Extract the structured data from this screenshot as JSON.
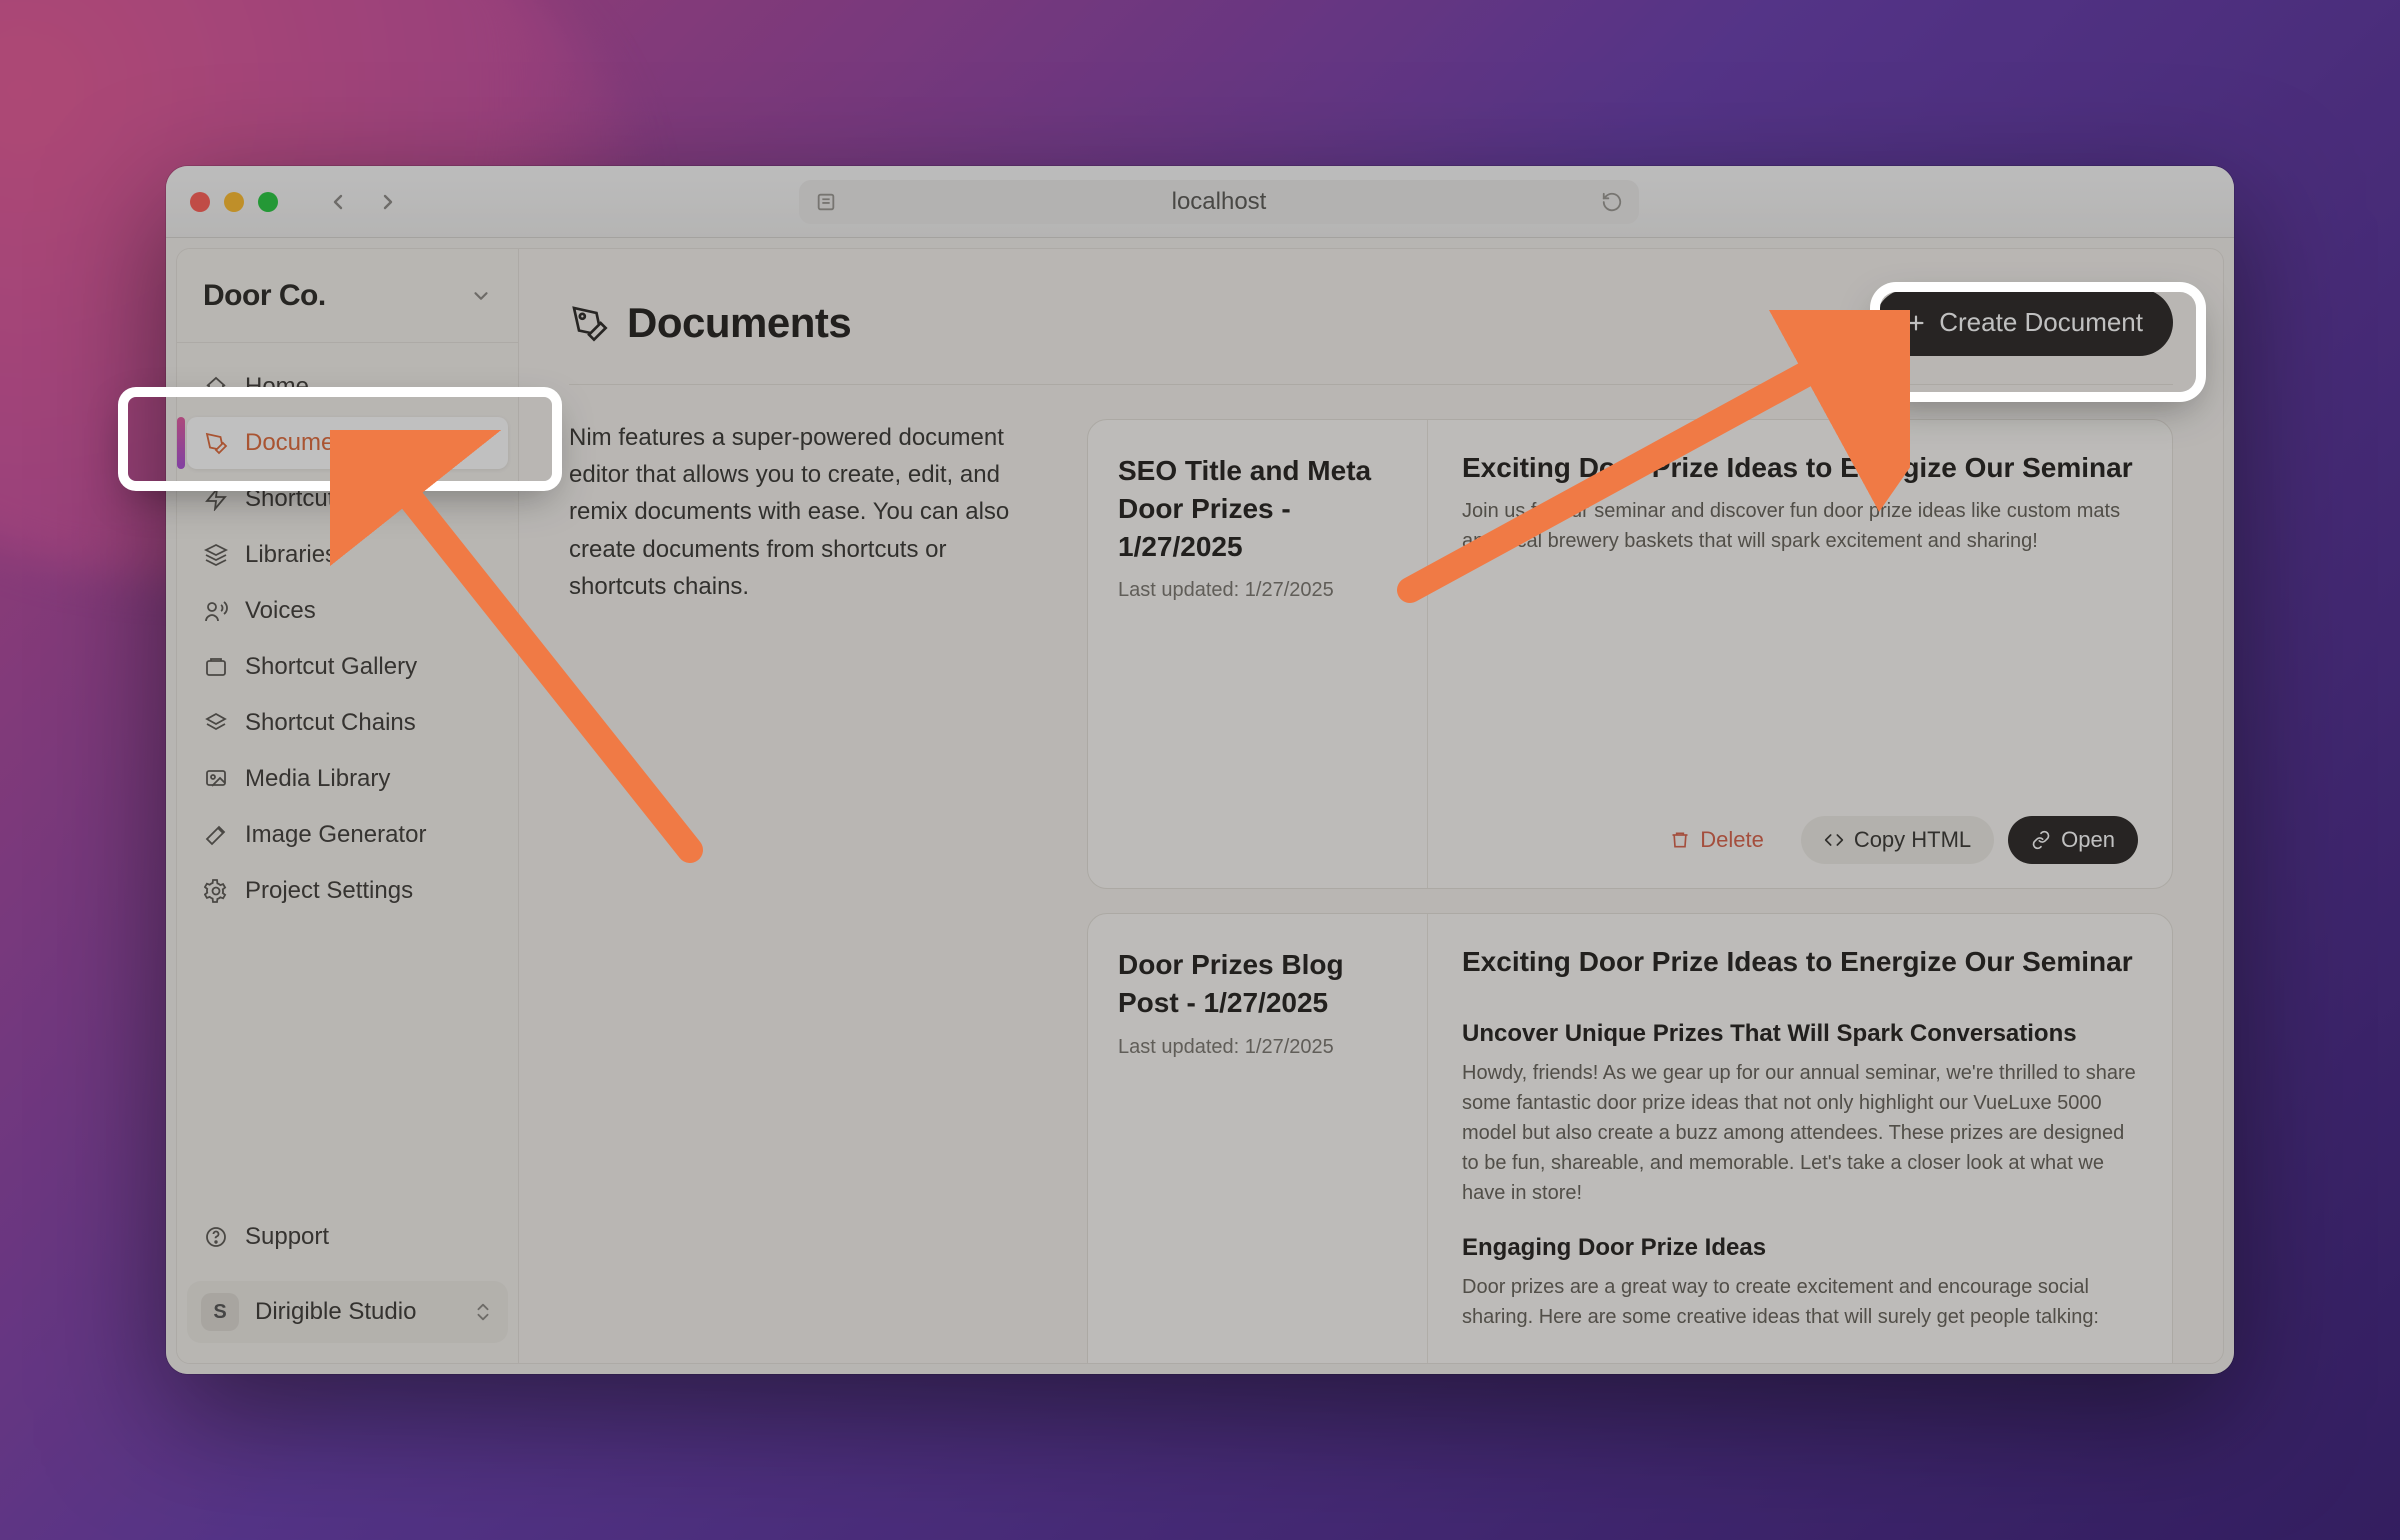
{
  "browser": {
    "address": "localhost"
  },
  "sidebar": {
    "org_name": "Door Co.",
    "items": [
      {
        "label": "Home"
      },
      {
        "label": "Documents"
      },
      {
        "label": "Shortcuts"
      },
      {
        "label": "Libraries"
      },
      {
        "label": "Voices"
      },
      {
        "label": "Shortcut Gallery"
      },
      {
        "label": "Shortcut Chains"
      },
      {
        "label": "Media Library"
      },
      {
        "label": "Image Generator"
      },
      {
        "label": "Project Settings"
      }
    ],
    "support_label": "Support",
    "workspace_badge": "S",
    "workspace_label": "Dirigible Studio"
  },
  "page": {
    "title": "Documents",
    "intro": "Nim features a super-powered document editor that allows you to create, edit, and remix documents with ease. You can also create documents from shortcuts or shortcuts chains.",
    "create_label": "Create Document"
  },
  "buttons": {
    "delete": "Delete",
    "copy": "Copy HTML",
    "open": "Open"
  },
  "documents": [
    {
      "title": "SEO Title and Meta Door Prizes - 1/27/2025",
      "updated_prefix": "Last updated: ",
      "updated": "1/27/2025",
      "heading": "Exciting Door Prize Ideas to Energize Our Seminar",
      "body": "Join us for our seminar and discover fun door prize ideas like custom mats and local brewery baskets that will spark excitement and sharing!"
    },
    {
      "title": "Door Prizes Blog Post - 1/27/2025",
      "updated_prefix": "Last updated: ",
      "updated": "1/27/2025",
      "heading": "Exciting Door Prize Ideas to Energize Our Seminar",
      "sub1": "Uncover Unique Prizes That Will Spark Conversations",
      "body1": "Howdy, friends! As we gear up for our annual seminar, we're thrilled to share some fantastic door prize ideas that not only highlight our VueLuxe 5000 model but also create a buzz among attendees. These prizes are designed to be fun, shareable, and memorable. Let's take a closer look at what we have in store!",
      "sub2": "Engaging Door Prize Ideas",
      "body2": "Door prizes are a great way to create excitement and encourage social sharing. Here are some creative ideas that will surely get people talking:"
    }
  ]
}
